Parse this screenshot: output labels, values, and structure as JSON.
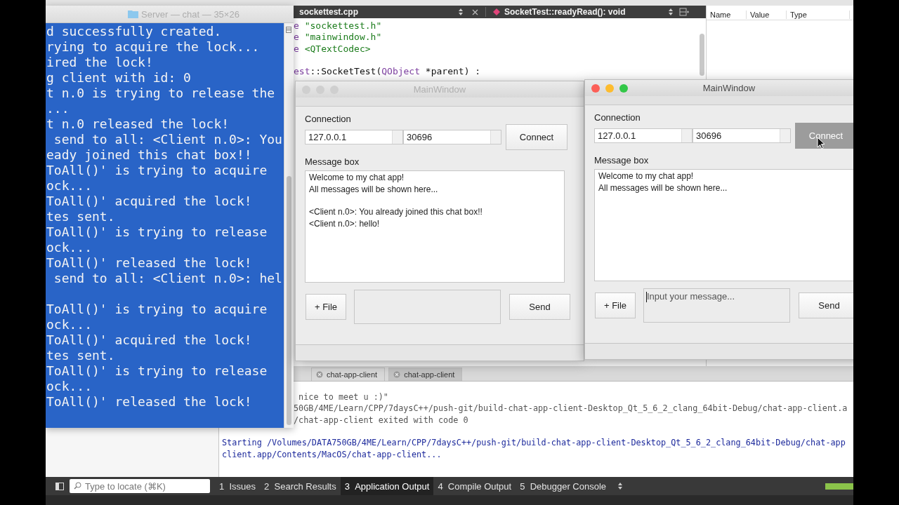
{
  "ide": {
    "editor": {
      "file": "sockettest.cpp",
      "symbol": "SocketTest::readyRead(): void",
      "code_lines": [
        {
          "spaced": false,
          "parts": [
            {
              "text": "e ",
              "kind": "keyword"
            },
            {
              "text": "\"sockettest.h\"",
              "kind": "string"
            }
          ]
        },
        {
          "spaced": false,
          "parts": [
            {
              "text": "e ",
              "kind": "keyword"
            },
            {
              "text": "\"mainwindow.h\"",
              "kind": "string"
            }
          ]
        },
        {
          "spaced": false,
          "parts": [
            {
              "text": "e ",
              "kind": "keyword"
            },
            {
              "text": "<QTextCodec>",
              "kind": "string"
            }
          ]
        },
        {
          "spaced": true,
          "parts": [
            {
              "text": "est",
              "kind": "keyword"
            },
            {
              "text": "::SocketTest(",
              "kind": "plain"
            },
            {
              "text": "QObject",
              "kind": "keyword"
            },
            {
              "text": " *parent) :",
              "kind": "plain"
            }
          ]
        }
      ]
    },
    "locals_panel": {
      "columns": [
        "Name",
        "Value",
        "Type"
      ]
    },
    "output_tabs": [
      {
        "label": "chat-app-client",
        "selected": false
      },
      {
        "label": "chat-app-client",
        "selected": true
      }
    ],
    "output_lines": [
      {
        "text": " nice to meet u :)\"",
        "kind": "plain",
        "covered": true,
        "spaced": false
      },
      {
        "text": "50GB/4ME/Learn/CPP/7daysC++/push-git/build-chat-app-client-Desktop_Qt_5_6_2_clang_64bit-Debug/chat-app-client.a",
        "kind": "plain",
        "covered": true,
        "spaced": false
      },
      {
        "text": "/chat-app-client exited with code 0",
        "kind": "plain",
        "covered": true,
        "spaced": false
      },
      {
        "text": "Starting /Volumes/DATA750GB/4ME/Learn/CPP/7daysC++/push-git/build-chat-app-client-Desktop_Qt_5_6_2_clang_64bit-Debug/chat-app",
        "kind": "info",
        "covered": false,
        "spaced": true
      },
      {
        "text": "client.app/Contents/MacOS/chat-app-client...",
        "kind": "info",
        "covered": false,
        "spaced": false
      }
    ],
    "locate": {
      "placeholder": "Type to locate (⌘K)"
    },
    "panes": [
      {
        "number": "1",
        "label": "Issues",
        "selected": false
      },
      {
        "number": "2",
        "label": "Search Results",
        "selected": false
      },
      {
        "number": "3",
        "label": "Application Output",
        "selected": true
      },
      {
        "number": "4",
        "label": "Compile Output",
        "selected": false
      },
      {
        "number": "5",
        "label": "Debugger Console",
        "selected": false
      }
    ]
  },
  "terminal": {
    "title": "Server — chat — 35×26",
    "lines": [
      {
        "text": "d successfully created.",
        "spaced": false
      },
      {
        "text": "rying to acquire the lock...",
        "spaced": false
      },
      {
        "text": "ired the lock!",
        "spaced": false
      },
      {
        "text": "g client with id: 0",
        "spaced": false
      },
      {
        "text": "t n.0 is trying to release the",
        "spaced": false
      },
      {
        "text": "...",
        "spaced": false
      },
      {
        "text": "t n.0 released the lock!",
        "spaced": false
      },
      {
        "text": " send to all: <Client n.0>: You",
        "spaced": false
      },
      {
        "text": "eady joined this chat box!!",
        "spaced": false
      },
      {
        "text": "ToAll()' is trying to acquire",
        "spaced": false
      },
      {
        "text": "ock...",
        "spaced": false
      },
      {
        "text": "ToAll()' acquired the lock!",
        "spaced": false
      },
      {
        "text": "tes sent.",
        "spaced": false
      },
      {
        "text": "ToAll()' is trying to release",
        "spaced": false
      },
      {
        "text": "ock...",
        "spaced": false
      },
      {
        "text": "ToAll()' released the lock!",
        "spaced": false
      },
      {
        "text": " send to all: <Client n.0>: hel",
        "spaced": false
      },
      {
        "text": "ToAll()' is trying to acquire",
        "spaced": true
      },
      {
        "text": "ock...",
        "spaced": false
      },
      {
        "text": "ToAll()' acquired the lock!",
        "spaced": false
      },
      {
        "text": "tes sent.",
        "spaced": false
      },
      {
        "text": "ToAll()' is trying to release",
        "spaced": false
      },
      {
        "text": "ock...",
        "spaced": false
      },
      {
        "text": "ToAll()' released the lock!",
        "spaced": false
      }
    ]
  },
  "chat_windows": [
    {
      "title": "MainWindow",
      "active": false,
      "connection_label": "Connection",
      "host": "127.0.0.1",
      "port": "30696",
      "connect_button": {
        "label": "Connect",
        "pressed": false
      },
      "message_box_label": "Message box",
      "messages": [
        {
          "text": "Welcome to my chat app!",
          "spaced": false
        },
        {
          "text": "All messages will be shown here...",
          "spaced": false
        },
        {
          "text": "<Client n.0>: You already joined this chat box!!",
          "spaced": true
        },
        {
          "text": "<Client n.0>: hello!",
          "spaced": false
        }
      ],
      "file_button": "+ File",
      "message_input": {
        "focused": false
      },
      "send_button": "Send"
    },
    {
      "title": "MainWindow",
      "active": true,
      "connection_label": "Connection",
      "host": "127.0.0.1",
      "port": "30696",
      "connect_button": {
        "label": "Connect",
        "pressed": true
      },
      "message_box_label": "Message box",
      "messages": [
        {
          "text": "Welcome to my chat app!",
          "spaced": false
        },
        {
          "text": "All messages will be shown here...",
          "spaced": false
        }
      ],
      "file_button": "+ File",
      "message_input": {
        "placeholder": "Input your message...",
        "focused": true
      },
      "send_button": "Send"
    }
  ]
}
